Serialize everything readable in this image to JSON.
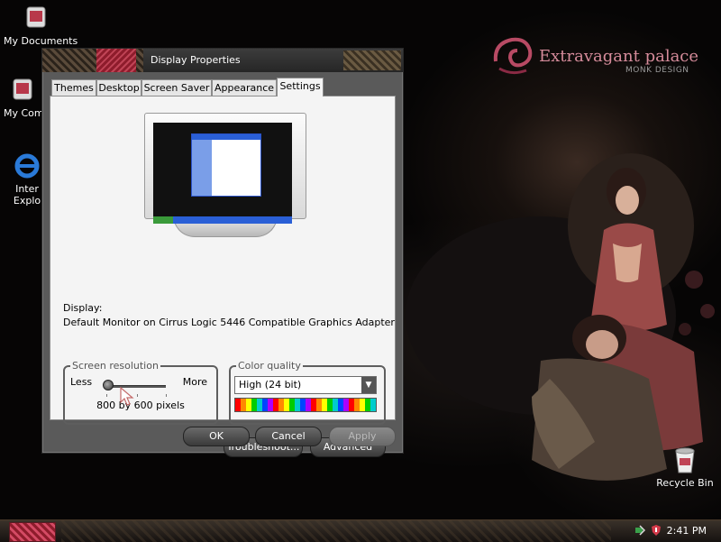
{
  "desktop": {
    "icons": [
      {
        "label": "My Documents",
        "icon": "my-documents-icon"
      },
      {
        "label": "My Comp",
        "icon": "my-computer-icon"
      },
      {
        "label": "Inter",
        "label2": "Explo",
        "icon": "internet-explorer-icon"
      },
      {
        "label": "Recycle Bin",
        "icon": "recycle-bin-icon"
      }
    ],
    "brand": {
      "title": "Extravagant palace",
      "subtitle": "MONK DESIGN"
    }
  },
  "dialog": {
    "title": "Display Properties",
    "tabs": [
      {
        "label": "Themes",
        "active": false
      },
      {
        "label": "Desktop",
        "active": false
      },
      {
        "label": "Screen Saver",
        "active": false
      },
      {
        "label": "Appearance",
        "active": false
      },
      {
        "label": "Settings",
        "active": true
      }
    ],
    "display_label": "Display:",
    "display_value": "Default Monitor on Cirrus Logic 5446 Compatible Graphics Adapter",
    "resolution": {
      "legend": "Screen resolution",
      "less": "Less",
      "more": "More",
      "value": "800 by 600 pixels",
      "slider_position": 0
    },
    "color_quality": {
      "legend": "Color quality",
      "selected": "High (24 bit)"
    },
    "buttons": {
      "troubleshoot": "Troubleshoot...",
      "advanced": "Advanced",
      "ok": "OK",
      "cancel": "Cancel",
      "apply": "Apply"
    }
  },
  "taskbar": {
    "clock": "2:41 PM"
  },
  "colors": {
    "accent_pink": "#d58b9a",
    "taskbar_red": "#8e1c2c"
  }
}
